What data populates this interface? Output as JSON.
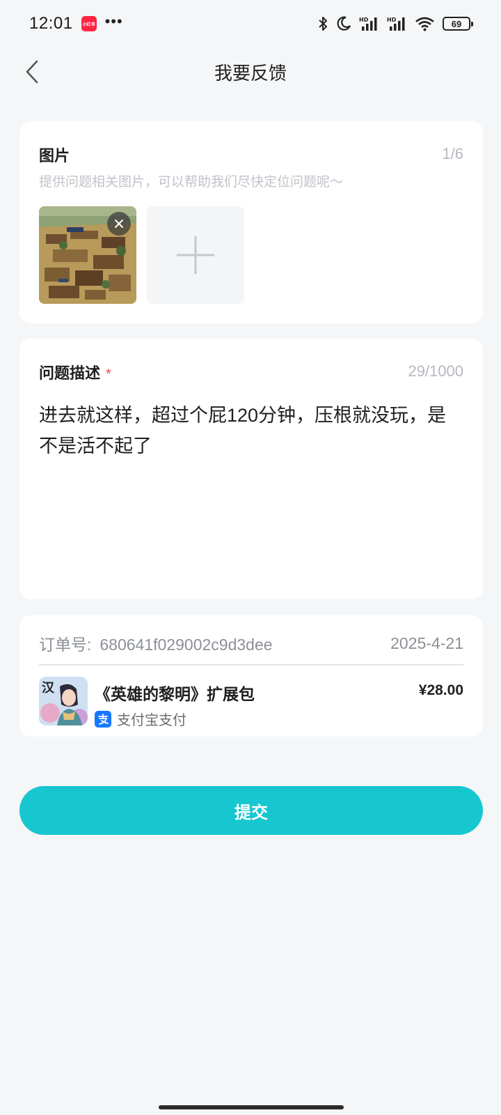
{
  "status_bar": {
    "time": "12:01",
    "app_badge": "小红书",
    "more": "•••",
    "icons": [
      "bluetooth-icon",
      "moon-icon",
      "hd-signal-icon",
      "hd-signal-icon",
      "wifi-icon"
    ],
    "battery": "69"
  },
  "nav": {
    "title": "我要反馈",
    "back_icon": "chevron-left-icon"
  },
  "images_section": {
    "title": "图片",
    "counter": "1/6",
    "hint": "提供问题相关图片，可以帮助我们尽快定位问题呢～",
    "thumbnails": [
      {
        "description": "game-screenshot",
        "remove_icon": "close-icon"
      }
    ],
    "add_icon": "plus-icon"
  },
  "description_section": {
    "title": "问题描述",
    "required_mark": "*",
    "counter": "29/1000",
    "text": "进去就这样，超过个屁120分钟，压根就没玩，是不是活不起了"
  },
  "order": {
    "label": "订单号:",
    "number": "680641f029002c9d3dee",
    "date": "2025-4-21",
    "product_name": "《英雄的黎明》扩展包",
    "price": "¥28.00",
    "payment_method": "支付宝支付",
    "payment_icon": "alipay-icon",
    "product_icon_text": "汉"
  },
  "submit": {
    "label": "提交"
  },
  "colors": {
    "accent": "#16c7cf",
    "background": "#f4f6f8",
    "required": "#f04545",
    "alipay": "#1677ff"
  }
}
